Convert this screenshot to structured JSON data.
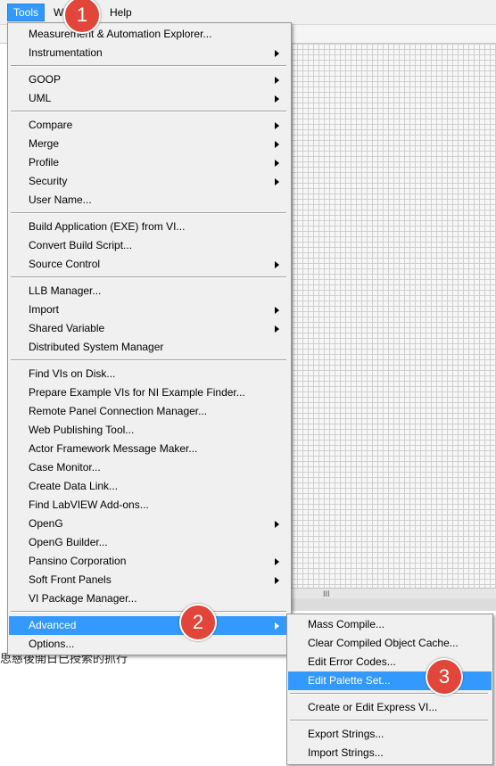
{
  "menubar": {
    "items": [
      "Tools",
      "W",
      "Help"
    ]
  },
  "background_text": "思慈後開日已授索的抓行",
  "scrollbar_grip": "III",
  "tools_menu": {
    "items": [
      "Measurement & Automation Explorer...",
      "Instrumentation",
      "GOOP",
      "UML",
      "Compare",
      "Merge",
      "Profile",
      "Security",
      "User Name...",
      "Build Application (EXE) from VI...",
      "Convert Build Script...",
      "Source Control",
      "LLB Manager...",
      "Import",
      "Shared Variable",
      "Distributed System Manager",
      "Find VIs on Disk...",
      "Prepare Example VIs for NI Example Finder...",
      "Remote Panel Connection Manager...",
      "Web Publishing Tool...",
      "Actor Framework Message Maker...",
      "Case Monitor...",
      "Create Data Link...",
      "Find LabVIEW Add-ons...",
      "OpenG",
      "OpenG Builder...",
      "Pansino Corporation",
      "Soft Front Panels",
      "VI Package Manager...",
      "Advanced",
      "Options..."
    ]
  },
  "advanced_submenu": {
    "items": [
      "Mass Compile...",
      "Clear Compiled Object Cache...",
      "Edit Error Codes...",
      "Edit Palette Set...",
      "Create or Edit Express VI...",
      "Export Strings...",
      "Import Strings..."
    ]
  },
  "step_badges": [
    "1",
    "2",
    "3"
  ],
  "colors": {
    "highlight": "#3399ff",
    "badge": "#e2453a",
    "menu_bg": "#f0f0f0"
  }
}
